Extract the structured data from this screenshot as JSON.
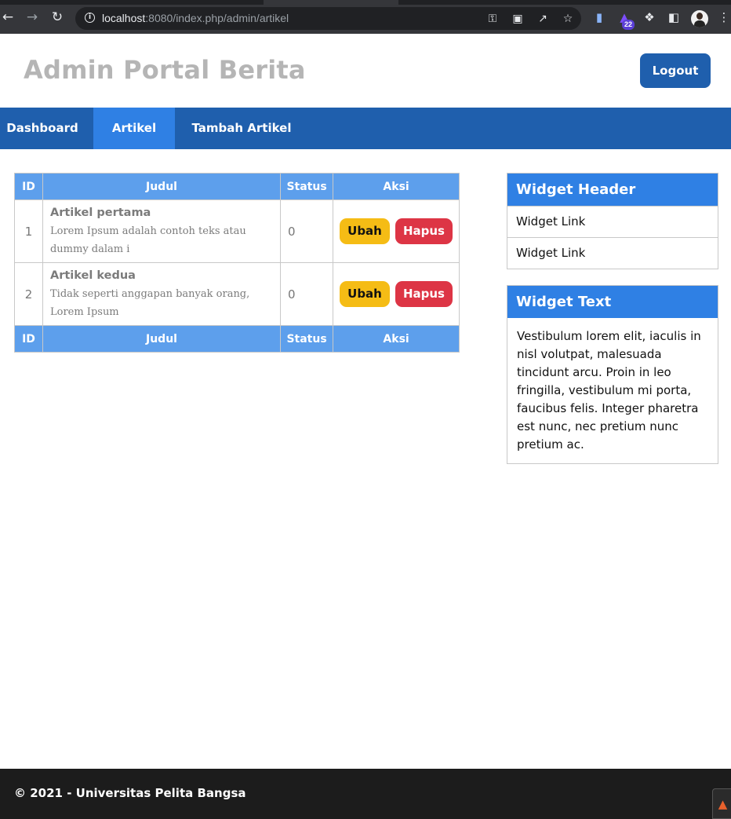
{
  "browser": {
    "url_host": "localhost",
    "url_path": ":8080/index.php/admin/artikel",
    "extension_badge": "22",
    "icons": {
      "back": "back-arrow-icon",
      "forward": "forward-arrow-icon",
      "reload": "reload-icon",
      "site_info": "info-icon",
      "password": "key-icon",
      "translate": "translate-icon",
      "share": "share-icon",
      "bookmark": "star-icon",
      "menu": "kebab-menu-icon"
    }
  },
  "header": {
    "title": "Admin Portal Berita",
    "logout_label": "Logout"
  },
  "nav": {
    "items": [
      {
        "label": "Dashboard",
        "active": false
      },
      {
        "label": "Artikel",
        "active": true
      },
      {
        "label": "Tambah Artikel",
        "active": false
      }
    ]
  },
  "table": {
    "columns": [
      "ID",
      "Judul",
      "Status",
      "Aksi"
    ],
    "rows": [
      {
        "id": "1",
        "title": "Artikel pertama",
        "excerpt": "Lorem Ipsum adalah contoh teks atau dummy dalam i",
        "status": "0",
        "edit_label": "Ubah",
        "delete_label": "Hapus"
      },
      {
        "id": "2",
        "title": "Artikel kedua",
        "excerpt": "Tidak seperti anggapan banyak orang, Lorem Ipsum",
        "status": "0",
        "edit_label": "Ubah",
        "delete_label": "Hapus"
      }
    ]
  },
  "sidebar": {
    "widget_header": {
      "title": "Widget Header",
      "links": [
        "Widget Link",
        "Widget Link"
      ]
    },
    "widget_text": {
      "title": "Widget Text",
      "body": "Vestibulum lorem elit, iaculis in nisl volutpat, malesuada tincidunt arcu. Proin in leo fringilla, vestibulum mi porta, faucibus felis. Integer pharetra est nunc, nec pretium nunc pretium ac."
    }
  },
  "footer": {
    "text": "© 2021 - Universitas Pelita Bangsa"
  },
  "colors": {
    "nav_bg": "#1f5fad",
    "nav_active": "#2f80e4",
    "table_header": "#5d9fec",
    "edit_button": "#f5bc15",
    "delete_button": "#dd3545",
    "footer_bg": "#1c1c1c"
  }
}
